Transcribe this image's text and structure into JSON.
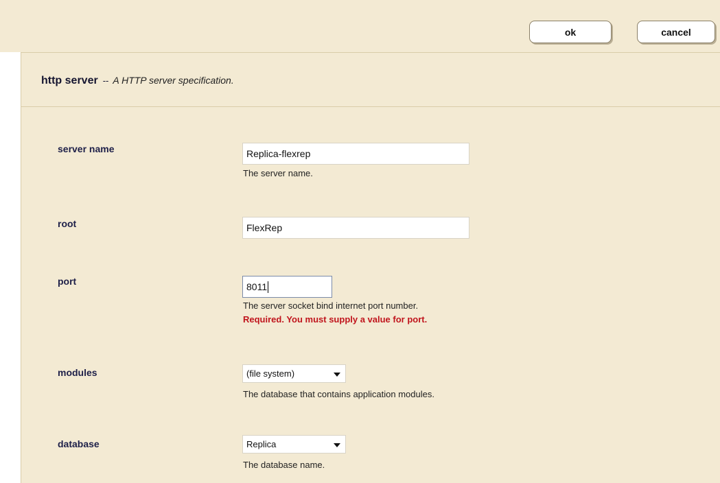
{
  "toolbar": {
    "ok_label": "ok",
    "cancel_label": "cancel"
  },
  "header": {
    "title": "http server",
    "separator": "--",
    "description": "A HTTP server specification."
  },
  "fields": {
    "server_name": {
      "label": "server name",
      "value": "Replica-flexrep",
      "help": "The server name."
    },
    "root": {
      "label": "root",
      "value": "FlexRep"
    },
    "port": {
      "label": "port",
      "value": "8011",
      "help": "The server socket bind internet port number.",
      "error": "Required. You must supply a value for port."
    },
    "modules": {
      "label": "modules",
      "selected": "(file system)",
      "help": "The database that contains application modules."
    },
    "database": {
      "label": "database",
      "selected": "Replica",
      "help": "The database name."
    }
  },
  "colors": {
    "background": "#f3ead3",
    "label": "#1d1f48",
    "error": "#c0141c"
  }
}
